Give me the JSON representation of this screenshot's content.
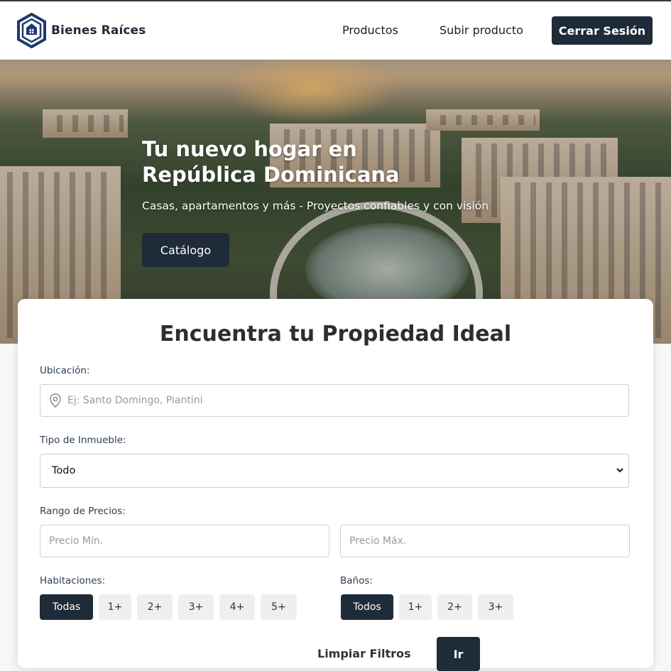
{
  "brand": {
    "name": "Bienes Raíces",
    "color": "#1e2b38"
  },
  "nav": {
    "products": "Productos",
    "upload": "Subir producto",
    "logout": "Cerrar Sesión"
  },
  "hero": {
    "title": "Tu nuevo hogar en República Dominicana",
    "subtitle": "Casas, apartamentos y más - Proyectos confiables y con visión",
    "cta": "Catálogo"
  },
  "search": {
    "title": "Encuentra tu Propiedad Ideal",
    "location": {
      "label": "Ubicación:",
      "placeholder": "Ej: Santo Domingo, Piantini",
      "icon": "map-pin-icon"
    },
    "type": {
      "label": "Tipo de Inmueble:",
      "selected": "Todo"
    },
    "price": {
      "label": "Rango de Precios:",
      "min_placeholder": "Precio Mín.",
      "max_placeholder": "Precio Máx."
    },
    "rooms": {
      "label": "Habitaciones:",
      "options": [
        "Todas",
        "1+",
        "2+",
        "3+",
        "4+",
        "5+"
      ],
      "selected": "Todas"
    },
    "baths": {
      "label": "Baños:",
      "options": [
        "Todos",
        "1+",
        "2+",
        "3+"
      ],
      "selected": "Todos"
    },
    "clear": "Limpiar Filtros",
    "submit": "Ir"
  }
}
